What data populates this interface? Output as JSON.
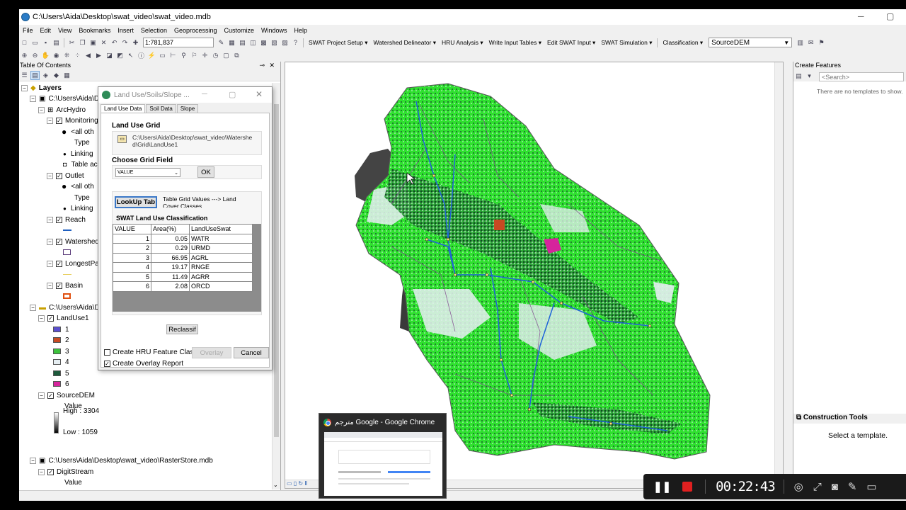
{
  "window": {
    "title": "C:\\Users\\Aida\\Desktop\\swat_video\\swat_video.mdb",
    "minimize": "─",
    "maximize": "▢"
  },
  "menu": [
    "File",
    "Edit",
    "View",
    "Bookmarks",
    "Insert",
    "Selection",
    "Geoprocessing",
    "Customize",
    "Windows",
    "Help"
  ],
  "toolbar": {
    "scale": "1:781,837",
    "menus": [
      "SWAT Project Setup ▾",
      "Watershed Delineator ▾",
      "HRU Analysis ▾",
      "Write Input Tables ▾",
      "Edit SWAT Input ▾",
      "SWAT Simulation ▾"
    ],
    "classification": "Classification ▾",
    "layer_select": "SourceDEM"
  },
  "toc": {
    "title": "Table Of Contents",
    "close": "✕",
    "items": [
      {
        "label": "Layers",
        "bold": true
      },
      {
        "label": "C:\\Users\\Aida\\D"
      },
      {
        "label": "ArcHydro"
      },
      {
        "label": "Monitoring"
      },
      {
        "label": "<all oth"
      },
      {
        "label": "Type"
      },
      {
        "label": "Linking"
      },
      {
        "label": "Table ac"
      },
      {
        "label": "Outlet"
      },
      {
        "label": "<all oth"
      },
      {
        "label": "Type"
      },
      {
        "label": "Linking"
      },
      {
        "label": "Reach"
      },
      {
        "label": "Watershed"
      },
      {
        "label": "LongestPa"
      },
      {
        "label": "Basin"
      },
      {
        "label": "C:\\Users\\Aida\\D"
      },
      {
        "label": "LandUse1"
      },
      {
        "label": "1"
      },
      {
        "label": "2"
      },
      {
        "label": "3"
      },
      {
        "label": "4"
      },
      {
        "label": "5"
      },
      {
        "label": "6"
      },
      {
        "label": "SourceDEM"
      },
      {
        "label": "Value"
      },
      {
        "label": "High : 3304"
      },
      {
        "label": "Low : 1059"
      },
      {
        "label": "C:\\Users\\Aida\\Desktop\\swat_video\\RasterStore.mdb"
      },
      {
        "label": "DigitStream"
      },
      {
        "label": "Value"
      }
    ],
    "landuse_colors": [
      "#5b4fcf",
      "#c84a22",
      "#3cc23c",
      "#e6eef2",
      "#1e5a3c",
      "#d6249c"
    ]
  },
  "dialog": {
    "title": "Land Use/Soils/Slope ...",
    "tabs": [
      "Land Use Data",
      "Soil Data",
      "Slope"
    ],
    "land_use_grid_label": "Land Use Grid",
    "land_use_grid_path": "C:\\Users\\Aida\\Desktop\\swat_video\\Watershed\\Grid\\LandUse1",
    "choose_field_label": "Choose Grid Field",
    "field_value": "VALUE",
    "ok": "OK",
    "lookup_button": "LookUp Tab",
    "lookup_desc": "Table Grid Values ---> Land Cover Classes",
    "classification_label": "SWAT Land Use Classification",
    "table_headers": [
      "VALUE",
      "Area(%)",
      "LandUseSwat"
    ],
    "table_rows": [
      [
        "1",
        "0.05",
        "WATR"
      ],
      [
        "2",
        "0.29",
        "URMD"
      ],
      [
        "3",
        "66.95",
        "AGRL"
      ],
      [
        "4",
        "19.17",
        "RNGE"
      ],
      [
        "5",
        "11.49",
        "AGRR"
      ],
      [
        "6",
        "2.08",
        "ORCD"
      ]
    ],
    "reclassify": "Reclassif",
    "create_hru": "Create HRU Feature Class",
    "create_overlay": "Create Overlay Report",
    "overlay": "Overlay",
    "cancel": "Cancel"
  },
  "right_panel": {
    "title": "Create Features",
    "search_placeholder": "<Search>",
    "no_templates": "There are no templates to show.",
    "construction_tools": "Construction Tools",
    "select_template": "Select a template."
  },
  "chrome_popup": {
    "title": "مترجم Google - Google Chrome"
  },
  "recorder": {
    "timer": "00:22:43"
  }
}
